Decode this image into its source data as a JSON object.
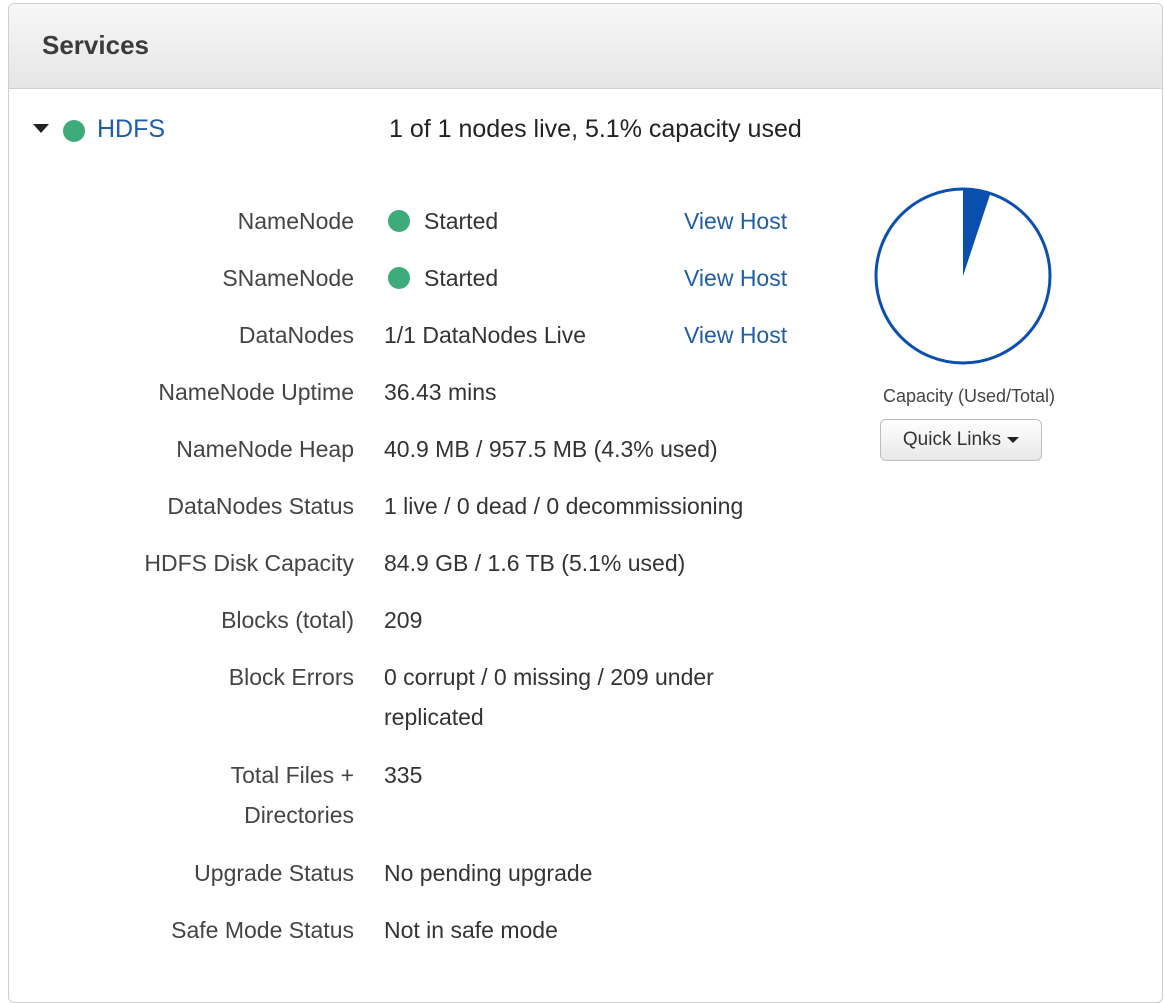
{
  "panel": {
    "title": "Services"
  },
  "service": {
    "name": "HDFS",
    "status_color": "#3dab7a",
    "summary": "1 of 1 nodes live, 5.1% capacity used"
  },
  "components": [
    {
      "label": "NameNode",
      "status": "Started",
      "link": "View Host",
      "status_icon": "green-dot"
    },
    {
      "label": "SNameNode",
      "status": "Started",
      "link": "View Host",
      "status_icon": "green-dot"
    },
    {
      "label": "DataNodes",
      "status": "1/1 DataNodes Live",
      "link": "View Host"
    }
  ],
  "metrics": [
    {
      "label": "NameNode Uptime",
      "value": "36.43 mins"
    },
    {
      "label": "NameNode Heap",
      "value": "40.9 MB / 957.5 MB (4.3% used)"
    },
    {
      "label": "DataNodes Status",
      "value": "1 live / 0 dead / 0 decommissioning"
    },
    {
      "label": "HDFS Disk Capacity",
      "value": "84.9 GB / 1.6 TB (5.1% used)"
    },
    {
      "label": "Blocks (total)",
      "value": "209"
    },
    {
      "label": "Block Errors",
      "value": "0 corrupt / 0 missing / 209 under replicated"
    },
    {
      "label": "Total Files + Directories",
      "value": "335"
    },
    {
      "label": "Upgrade Status",
      "value": "No pending upgrade"
    },
    {
      "label": "Safe Mode Status",
      "value": "Not in safe mode"
    }
  ],
  "capacity_chart": {
    "caption": "Capacity (Used/Total)",
    "used_fraction": 0.051,
    "color": "#0b4fae"
  },
  "quick_links": {
    "label": "Quick Links"
  },
  "chart_data": {
    "type": "pie",
    "title": "Capacity (Used/Total)",
    "slices": [
      {
        "name": "",
        "value": 5.1
      },
      {
        "name": "",
        "value": 94.9
      }
    ]
  }
}
